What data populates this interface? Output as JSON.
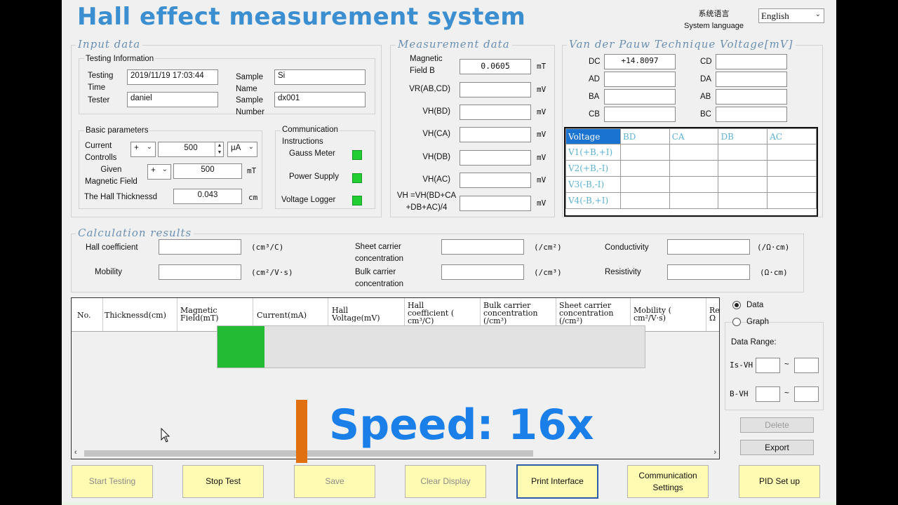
{
  "title": "Hall effect measurement system",
  "language": {
    "label_cn": "系统语言",
    "label": "System language",
    "selected": "English"
  },
  "input": {
    "legend": "Input data",
    "testing_info": {
      "legend": "Testing Information",
      "testing_time_label": "Testing\nTime",
      "testing_time_value": "2019/11/19 17:03:44",
      "tester_label": "Tester",
      "tester_value": "daniel",
      "sample_name_label": "Sample\nName",
      "sample_name_value": "Si",
      "sample_number_label": "Sample\nNumber",
      "sample_number_value": "dx001"
    },
    "basic": {
      "legend": "Basic parameters",
      "current_label": "Current\nControlls",
      "current_sign": "+",
      "current_value": "500",
      "current_unit": "μA",
      "field_label": "Given\nMagnetic Field",
      "field_sign": "+",
      "field_value": "500",
      "field_unit": "mT",
      "thickness_label": "The Hall Thicknessd",
      "thickness_value": "0.043",
      "thickness_unit": "cm"
    },
    "comm": {
      "legend": "Communication\nInstructions",
      "gauss": "Gauss Meter",
      "power": "Power Supply",
      "logger": "Voltage Logger",
      "led_color": "#22cc33"
    }
  },
  "measurement": {
    "legend": "Measurement data",
    "rows": [
      {
        "label": "Magnetic\nField B",
        "value": "0.0605",
        "unit": "mT"
      },
      {
        "label": "VR(AB,CD)",
        "value": "",
        "unit": "mV"
      },
      {
        "label": "VH(BD)",
        "value": "",
        "unit": "mV"
      },
      {
        "label": "VH(CA)",
        "value": "",
        "unit": "mV"
      },
      {
        "label": "VH(DB)",
        "value": "",
        "unit": "mV"
      },
      {
        "label": "VH(AC)",
        "value": "",
        "unit": "mV"
      },
      {
        "label": "VH =VH(BD+CA\n+DB+AC)/4",
        "value": "",
        "unit": "mV"
      }
    ]
  },
  "vdp": {
    "legend": "Van der Pauw Technique Voltage[mV]",
    "left": [
      {
        "label": "DC",
        "value": "+14.8097"
      },
      {
        "label": "AD",
        "value": ""
      },
      {
        "label": "BA",
        "value": ""
      },
      {
        "label": "CB",
        "value": ""
      }
    ],
    "right": [
      {
        "label": "CD",
        "value": ""
      },
      {
        "label": "DA",
        "value": ""
      },
      {
        "label": "AB",
        "value": ""
      },
      {
        "label": "BC",
        "value": ""
      }
    ],
    "table_headers": [
      "Voltage",
      "BD",
      "CA",
      "DB",
      "AC"
    ],
    "table_rows": [
      "V1(+B,+I)",
      "V2(+B,-I)",
      "V3(-B,-I)",
      "V4(-B,+I)"
    ]
  },
  "calc": {
    "legend": "Calculation results",
    "hall_label": "Hall coefficient",
    "hall_unit": "(cm³/C)",
    "mobility_label": "Mobility",
    "mobility_unit": "(cm²/V·s)",
    "sheet_label": "Sheet carrier\nconcentration",
    "sheet_unit": "(/cm²)",
    "bulk_label": "Bulk carrier\nconcentration",
    "bulk_unit": "(/cm³)",
    "cond_label": "Conductivity",
    "cond_unit": "(/Ω·cm)",
    "resist_label": "Resistivity",
    "resist_unit": "(Ω·cm)"
  },
  "grid": {
    "columns": [
      "No.",
      "Thicknessd(cm)",
      "Magnetic\nField(mT)",
      "Current(mA)",
      "Hall\nVoltage(mV)",
      "Hall\ncoefficient (\ncm³/C)",
      "Bulk carrier\nconcentration\n(/cm³)",
      "Sheet carrier\nconcentration\n(/cm²)",
      "Mobility (\ncm²/V·s)",
      "Re\nΩ"
    ],
    "progress": 0.11,
    "progress_color": "#22bb33"
  },
  "view": {
    "data_label": "Data",
    "graph_label": "Graph",
    "selected": "Data",
    "range_label": "Data Range:",
    "is_vh": "Is-VH",
    "b_vh": "B-VH",
    "tilde": "~",
    "delete": "Delete",
    "export": "Export"
  },
  "overlay": {
    "speed": "Speed: 16x",
    "speed_color": "#1a7fe8",
    "marker_color": "#e07010"
  },
  "buttons": {
    "start": "Start Testing",
    "stop": "Stop Test",
    "save": "Save",
    "clear": "Clear Display",
    "print": "Print Interface",
    "comm_settings": "Communication\nSettings",
    "pid": "PID Set up"
  }
}
